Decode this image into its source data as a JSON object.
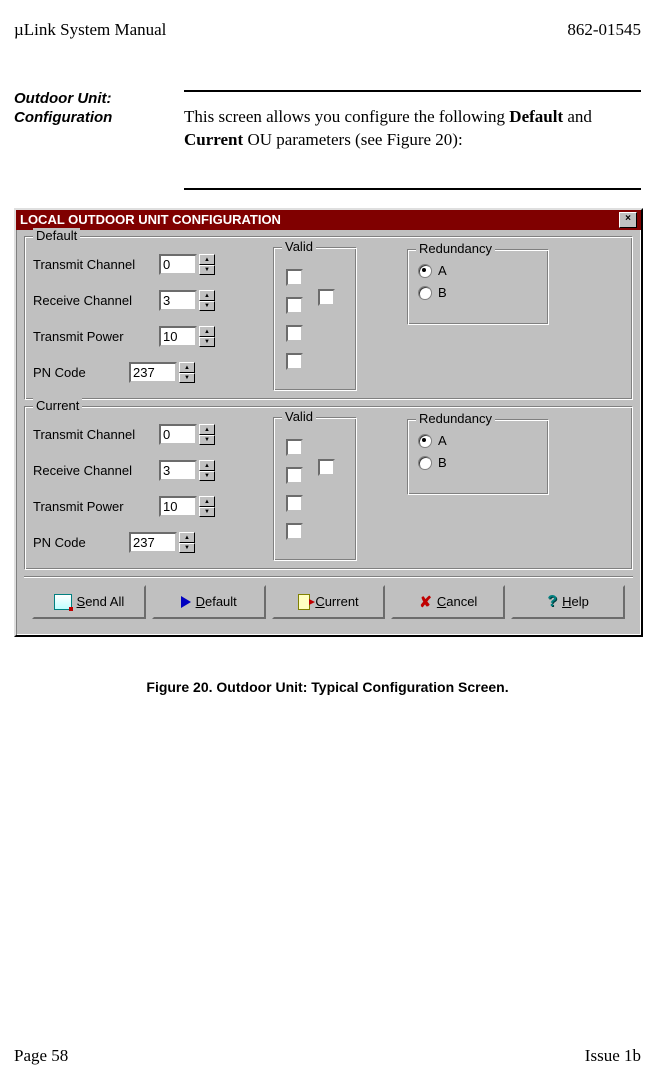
{
  "header": {
    "left": "µLink System Manual",
    "right": "862-01545"
  },
  "section": {
    "side_title_line1": "Outdoor Unit:",
    "side_title_line2": "Configuration",
    "body_plain1": "This screen allows you configure the following ",
    "body_bold1": "Default",
    "body_plain2": " and ",
    "body_bold2": "Current",
    "body_plain3": " OU parameters (see Figure 20):"
  },
  "dialog": {
    "title": "LOCAL OUTDOOR UNIT CONFIGURATION",
    "groups": {
      "default": {
        "legend": "Default",
        "fields": [
          {
            "label": "Transmit Channel",
            "value": "0"
          },
          {
            "label": "Receive Channel",
            "value": "3"
          },
          {
            "label": "Transmit Power",
            "value": "10"
          },
          {
            "label": "PN Code",
            "value": "237"
          }
        ],
        "valid_legend": "Valid",
        "redundancy": {
          "legend": "Redundancy",
          "a": "A",
          "b": "B",
          "selected": "A"
        }
      },
      "current": {
        "legend": "Current",
        "fields": [
          {
            "label": "Transmit Channel",
            "value": "0"
          },
          {
            "label": "Receive Channel",
            "value": "3"
          },
          {
            "label": "Transmit Power",
            "value": "10"
          },
          {
            "label": "PN Code",
            "value": "237"
          }
        ],
        "valid_legend": "Valid",
        "redundancy": {
          "legend": "Redundancy",
          "a": "A",
          "b": "B",
          "selected": "A"
        }
      }
    },
    "buttons": {
      "send_all_pre": "S",
      "send_all_post": "end All",
      "default_pre": "",
      "default_u": "D",
      "default_post": "efault",
      "current_pre": "",
      "current_u": "C",
      "current_post": "urrent",
      "cancel_pre": "",
      "cancel_u": "C",
      "cancel_post": "ancel",
      "help_pre": "",
      "help_u": "H",
      "help_post": "elp"
    }
  },
  "figure_caption": "Figure 20.  Outdoor Unit:  Typical Configuration Screen.",
  "footer": {
    "left": "Page 58",
    "right": "Issue 1b"
  }
}
